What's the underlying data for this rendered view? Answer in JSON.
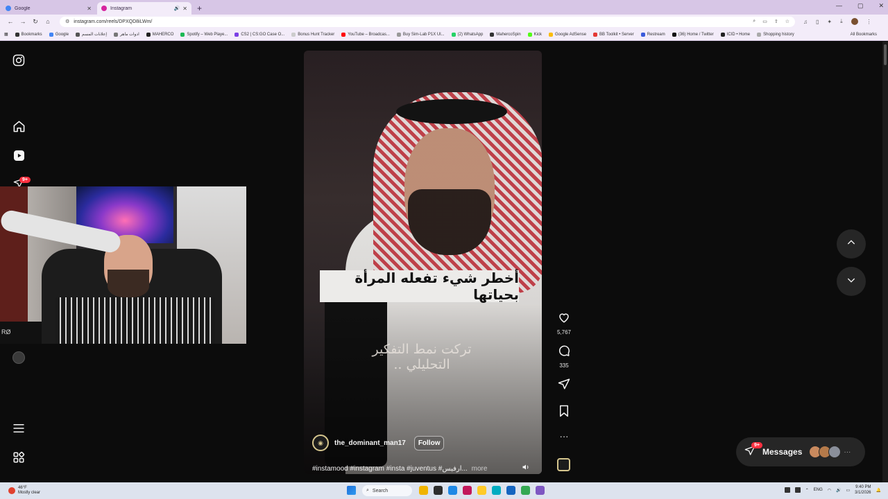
{
  "browser": {
    "tabs": [
      {
        "title": "Google",
        "color": "#4285f4"
      },
      {
        "title": "Instagram",
        "color": "#d6249f"
      }
    ],
    "url": "instagram.com/reels/DPXQD8iLWm/",
    "window_controls": [
      "—",
      "▢",
      "✕"
    ]
  },
  "bookmarks": [
    {
      "label": "Bookmarks",
      "color": "#333333"
    },
    {
      "label": "Google",
      "color": "#4285f4"
    },
    {
      "label": "إعلانات المسم",
      "color": "#555555"
    },
    {
      "label": "ادوات ماهر",
      "color": "#777777"
    },
    {
      "label": "MAHERCO",
      "color": "#222222"
    },
    {
      "label": "Spotify – Web Playe...",
      "color": "#1db954"
    },
    {
      "label": "CS2 | CS:GO Case O...",
      "color": "#7b3fe4"
    },
    {
      "label": "Bonus Hunt Tracker",
      "color": "#cccccc"
    },
    {
      "label": "YouTube – Broadcas...",
      "color": "#ff0000"
    },
    {
      "label": "Buy Sim-Lab P1X Ul...",
      "color": "#999999"
    },
    {
      "label": "(2) WhatsApp",
      "color": "#25d366"
    },
    {
      "label": "MahercoSpin",
      "color": "#333333"
    },
    {
      "label": "Kick",
      "color": "#53fc18"
    },
    {
      "label": "Google AdSense",
      "color": "#fbbc04"
    },
    {
      "label": "BB Toolkit • Server",
      "color": "#e53935"
    },
    {
      "label": "Restream",
      "color": "#3b5bdb"
    },
    {
      "label": "(36) Home / Twitter",
      "color": "#111111"
    },
    {
      "label": "ICID • Home",
      "color": "#222222"
    },
    {
      "label": "Shopping history",
      "color": "#aaaaaa"
    }
  ],
  "bookmarks_all": "All Bookmarks",
  "sidebar": {
    "notification_badge": "9+"
  },
  "reel": {
    "caption_main": "أخطر شيء تفعله المرأة بحياتها",
    "caption_sub": "تركت نمط التفكير التحليلي ..",
    "username": "the_dominant_man17",
    "follow_label": "Follow",
    "tags": "#instamood #instagram #insta #juventus #ارفيس...",
    "more_label": "more"
  },
  "actions": {
    "likes": "5,767",
    "comments": "335"
  },
  "messages": {
    "label": "Messages",
    "badge": "9+",
    "more": "···",
    "avatars": [
      "#c98a5e",
      "#b57a4a",
      "#8a8f9a"
    ]
  },
  "webcam": {
    "mic_text": "RØ"
  },
  "taskbar": {
    "weather_temp": "46°F",
    "weather_desc": "Mostly clear",
    "search_placeholder": "Search",
    "apps": [
      "#f0b400",
      "#2d2d2d",
      "#1e88e5",
      "#c2185b",
      "#ffca28",
      "#00acc1",
      "#1565c0",
      "#34a853",
      "#7e57c2"
    ],
    "language": "ENG",
    "time": "9:40 PM",
    "date": "3/1/2026"
  }
}
